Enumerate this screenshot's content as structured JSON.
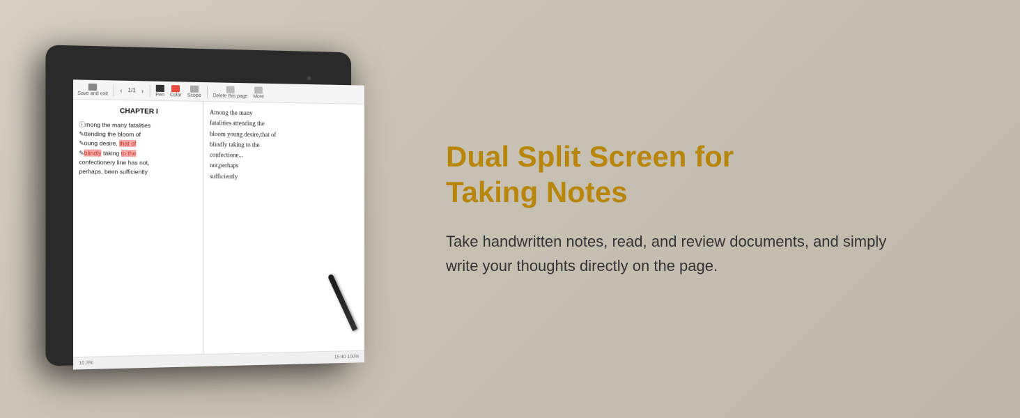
{
  "page": {
    "background": "linear-gradient(135deg, #d6d0c4, #bfb8aa)"
  },
  "tablet": {
    "toolbar": {
      "save_exit": "Save and exit",
      "page_indicator": "1/1",
      "pen_label": "Pen",
      "color_label": "Color",
      "scope_label": "Scope",
      "delete_label": "Delete this page",
      "more_label": "More"
    },
    "left_panel": {
      "chapter_title": "CHAPTER I",
      "text_lines": [
        "mong the many fatalities",
        "ttending the bloom of",
        "oung desire,",
        "blindly",
        "taking",
        "to the",
        "confectionery line has not,",
        "perhaps, been sufficiently"
      ],
      "highlighted_words": [
        "that of",
        "to the"
      ]
    },
    "right_panel": {
      "handwriting_lines": [
        "Among the many",
        "fatalities attending the",
        "bloom young desire,that of",
        "blindly taking to the",
        "confectione...",
        "not,perhaps",
        "sufficiently"
      ]
    },
    "footer": {
      "left_text": "10.3%",
      "right_text": "15:40 100%"
    }
  },
  "feature": {
    "title_line1": "Dual Split Screen for",
    "title_line2": "Taking Notes",
    "description": "Take handwritten notes, read, and review documents, and simply write your thoughts directly on the page."
  }
}
